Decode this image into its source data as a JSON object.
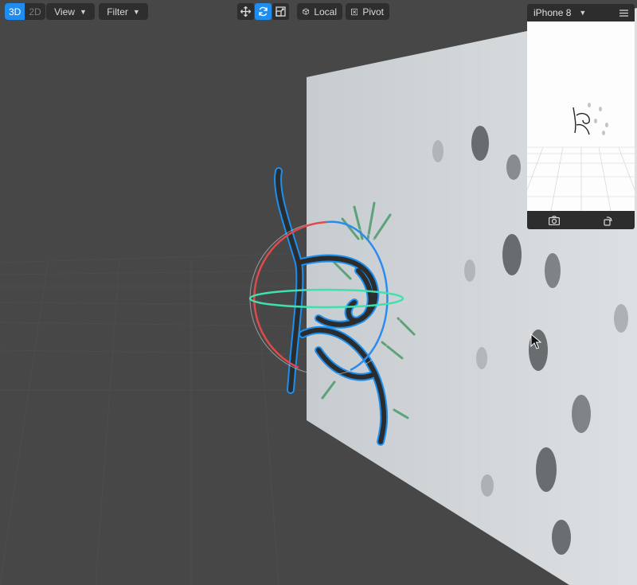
{
  "toolbar": {
    "mode_3d": "3D",
    "mode_2d": "2D",
    "view_label": "View",
    "filter_label": "Filter",
    "local_label": "Local",
    "pivot_label": "Pivot"
  },
  "preview": {
    "device_label": "iPhone 8"
  },
  "icons": {
    "move": "move-tool-icon",
    "rotate": "rotate-tool-icon",
    "scale": "scale-tool-icon",
    "cube": "cube-icon",
    "pivot": "pivot-icon",
    "menu": "hamburger-menu-icon",
    "screenshot": "camera-icon",
    "rotate_device": "rotate-device-icon",
    "cursor": "mouse-cursor-icon"
  },
  "colors": {
    "accent": "#1f8cf0",
    "gizmo_x": "#e04a4a",
    "gizmo_y": "#3fe0b0",
    "gizmo_z": "#2b8cf0"
  }
}
